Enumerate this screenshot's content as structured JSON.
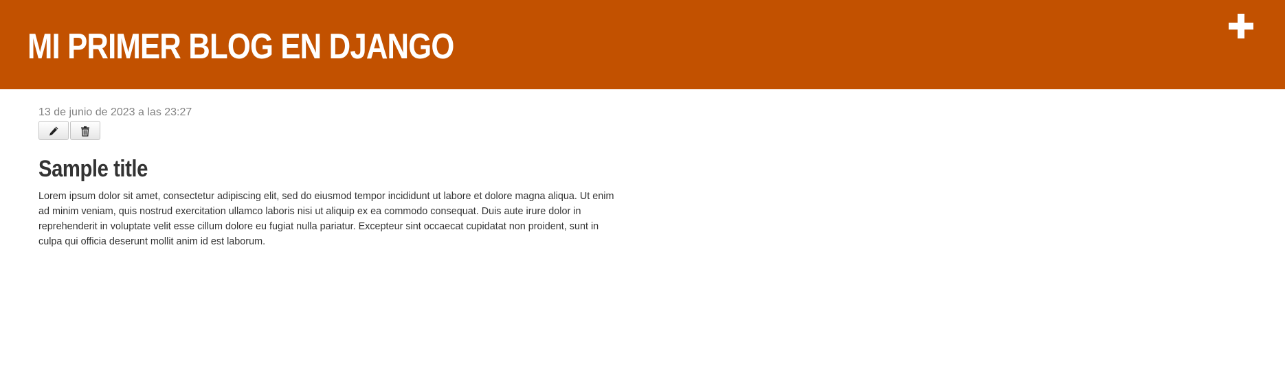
{
  "header": {
    "site_title": "Mi primer blog en Django",
    "add_icon": "plus-icon"
  },
  "post": {
    "date": "13 de junio de 2023 a las 23:27",
    "edit_icon": "pencil-icon",
    "delete_icon": "trash-icon",
    "title": "Sample title",
    "body": "Lorem ipsum dolor sit amet, consectetur adipiscing elit, sed do eiusmod tempor incididunt ut labore et dolore magna aliqua. Ut enim ad minim veniam, quis nostrud exercitation ullamco laboris nisi ut aliquip ex ea commodo consequat. Duis aute irure dolor in reprehenderit in voluptate velit esse cillum dolore eu fugiat nulla pariatur. Excepteur sint occaecat cupidatat non proident, sunt in culpa qui officia deserunt mollit anim id est laborum."
  },
  "colors": {
    "header_background": "#c25100",
    "header_text": "#ffffff",
    "date_text": "#828282",
    "body_text": "#333333"
  }
}
